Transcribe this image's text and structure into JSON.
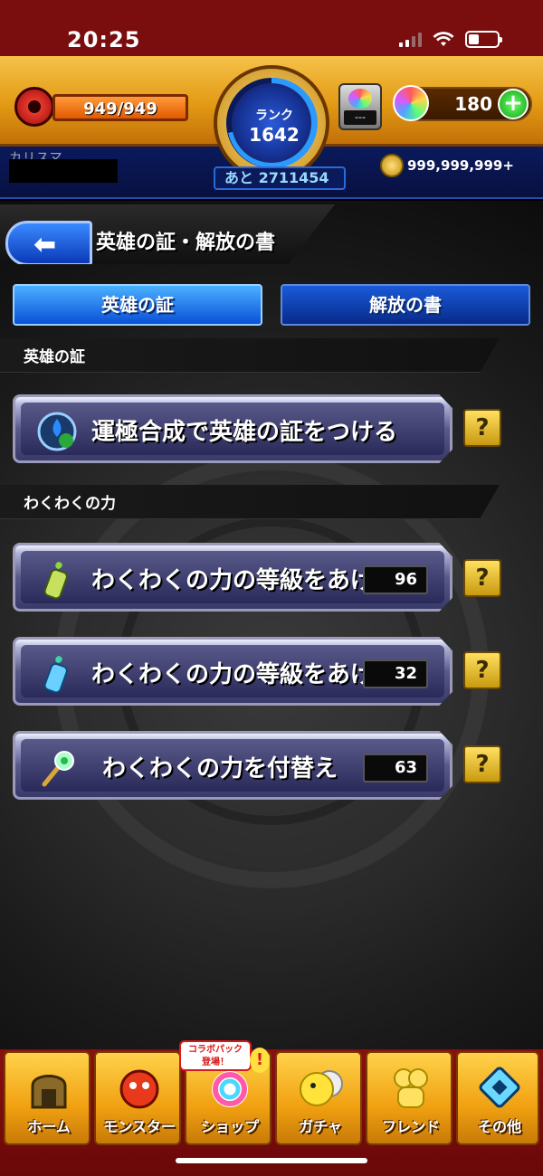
{
  "status_bar": {
    "time": "20:25"
  },
  "header": {
    "stamina": "949/949",
    "stamina_fraction": 1.0,
    "rank_label": "ランク",
    "rank_value": "1642",
    "exp_remaining": "あと 2711454",
    "item_count": "---",
    "orb_count": "180",
    "player_name": "カリスマ…",
    "gold": "999,999,999+"
  },
  "title": {
    "back_label": "",
    "page_title": "英雄の証・解放の書"
  },
  "tabs": [
    {
      "label": "英雄の証",
      "active": true
    },
    {
      "label": "解放の書",
      "active": false
    }
  ],
  "sections": {
    "hero": {
      "label": "英雄の証"
    },
    "waku": {
      "label": "わくわくの力"
    }
  },
  "menu": [
    {
      "label": "運極合成で英雄の証をつける",
      "count": null,
      "icon": "hero-proof-icon"
    },
    {
      "label": "わくわくの力の等級をあげる",
      "count": "96",
      "icon": "yellow-elixir-icon"
    },
    {
      "label": "わくわくの力の等級をあげる",
      "count": "32",
      "icon": "blue-elixir-icon"
    },
    {
      "label": "わくわくの力を付替え",
      "count": "63",
      "icon": "wand-icon"
    }
  ],
  "help_label": "?",
  "bottom_nav": [
    {
      "label": "ホーム",
      "icon": "home-icon"
    },
    {
      "label": "モンスター",
      "icon": "monster-icon"
    },
    {
      "label": "ショップ",
      "icon": "shop-icon"
    },
    {
      "label": "ガチャ",
      "icon": "gacha-icon"
    },
    {
      "label": "フレンド",
      "icon": "friend-icon"
    },
    {
      "label": "その他",
      "icon": "other-icon"
    }
  ],
  "shop_badge": "コラボパック\n登場！",
  "shop_alert": "!"
}
